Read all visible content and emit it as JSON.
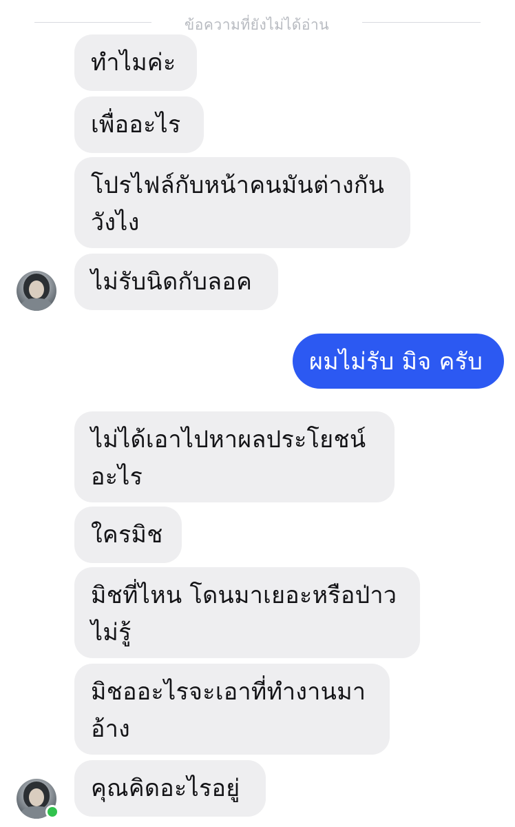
{
  "chat": {
    "unread_divider": "ข้อความที่ยังไม่ได้อ่าน",
    "messages": [
      {
        "sender": "other",
        "text": "ทำไมค่ะ"
      },
      {
        "sender": "other",
        "text": "เพื่ออะไร"
      },
      {
        "sender": "other",
        "text": "โปรไฟล์กับหน้าคนมันต่างกัน\nวังไง"
      },
      {
        "sender": "other",
        "text": "ไม่รับนิดกับลอค"
      },
      {
        "sender": "me",
        "text": "ผมไม่รับ มิจ ครับ"
      },
      {
        "sender": "other",
        "text": "ไม่ได้เอาไปหาผลประโยชน์\nอะไร"
      },
      {
        "sender": "other",
        "text": "ใครมิช"
      },
      {
        "sender": "other",
        "text": "มิชที่ไหน โดนมาเยอะหรือป่าว\nไม่รู้"
      },
      {
        "sender": "other",
        "text": "มิชออะไรจะเอาที่ทำงานมา\nอ้าง"
      },
      {
        "sender": "other",
        "text": "คุณคิดอะไรอยู่"
      }
    ]
  },
  "colors": {
    "incoming_bubble": "#eeeef0",
    "outgoing_bubble": "#2c59f2",
    "online_indicator": "#31c24d"
  },
  "icons": {
    "avatar": "contact-avatar-photo",
    "presence": "online-status-dot"
  }
}
